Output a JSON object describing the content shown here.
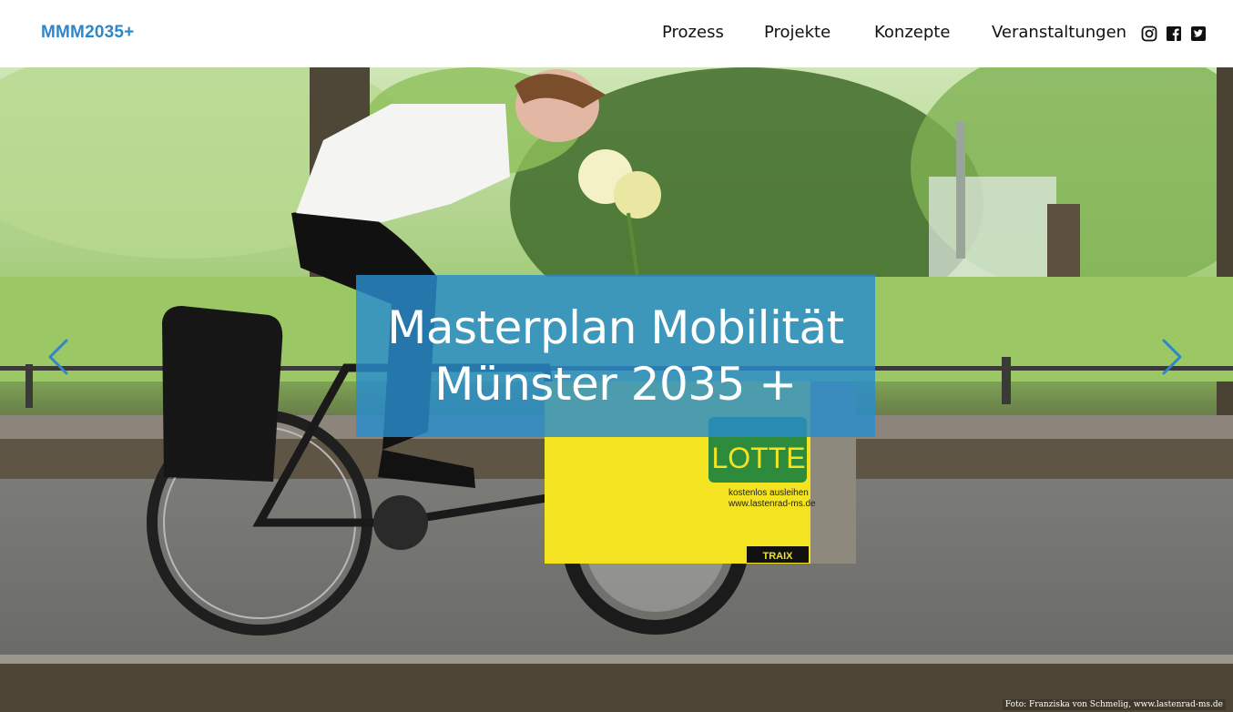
{
  "header": {
    "logo": "MMM2035+",
    "nav": [
      "Prozess",
      "Projekte",
      "Konzepte",
      "Veranstaltungen"
    ],
    "social_icons": [
      "instagram-icon",
      "facebook-icon",
      "twitter-icon"
    ]
  },
  "hero": {
    "title_line1": "Masterplan Mobilität",
    "title_line2": "Münster 2035 +",
    "prev_icon": "chevron-left-icon",
    "next_icon": "chevron-right-icon",
    "cargo_box_label": "LOTTE",
    "cargo_box_text1": "kostenlos ausleihen",
    "cargo_box_text2": "www.lastenrad-ms.de",
    "cargo_brand": "TRAIX",
    "photo_credit": "Foto: Franziska von Schmelig, www.lastenrad-ms.de"
  },
  "colors": {
    "brand_blue": "#2f86c8",
    "overlay_blue": "#288ccd",
    "nav_text": "#111111"
  }
}
